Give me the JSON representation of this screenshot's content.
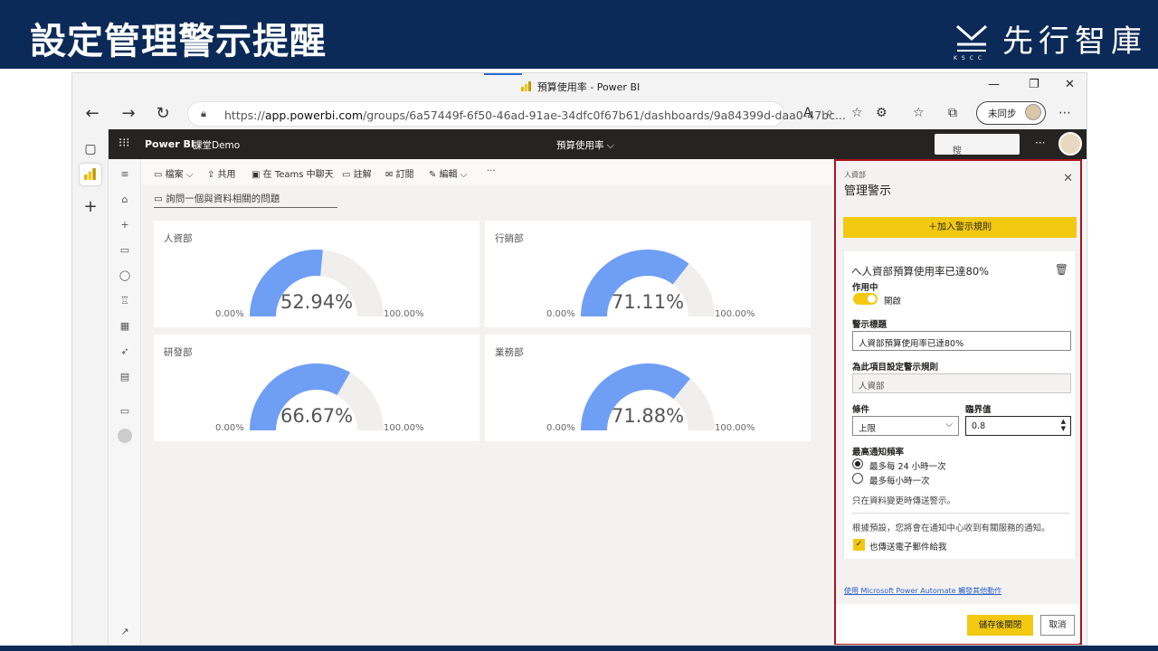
{
  "slide": {
    "title": "設定管理警示提醒",
    "logo_text": "先行智庫",
    "logo_sub": "KSCC"
  },
  "browser": {
    "tab_title": "預算使用率 - Power BI",
    "url_prefix": "https://",
    "url_host": "app.powerbi.com",
    "url_path": "/groups/6a57449f-6f50-46ad-91ae-34dfc0f67b61/dashboards/9a84399d-daa0-47bc...",
    "sync_label": "未同步",
    "window_controls": [
      "—",
      "❐",
      "✕"
    ]
  },
  "pbi": {
    "brand": "Power BI",
    "workspace": "課堂Demo",
    "center_title": "預算使用率 ⌵",
    "search_placeholder": "搜尋",
    "more": "···"
  },
  "commands": {
    "file": "檔案 ⌵",
    "share": "共用",
    "teams": "在 Teams 中聊天",
    "comment": "註解",
    "subscribe": "訂閱",
    "edit": "編輯 ⌵",
    "more": "···"
  },
  "qna_placeholder": "詢問一個與資料相關的問題",
  "tiles": [
    {
      "label": "人資部",
      "value": "52.94%",
      "fraction": 0.5294,
      "min": "0.00%",
      "max": "100.00%"
    },
    {
      "label": "行銷部",
      "value": "71.11%",
      "fraction": 0.7111,
      "min": "0.00%",
      "max": "100.00%"
    },
    {
      "label": "研發部",
      "value": "66.67%",
      "fraction": 0.6667,
      "min": "0.00%",
      "max": "100.00%"
    },
    {
      "label": "業務部",
      "value": "71.88%",
      "fraction": 0.7188,
      "min": "0.00%",
      "max": "100.00%"
    }
  ],
  "colors": {
    "gauge_fill": "#6f9ef5",
    "gauge_track": "#f0efee",
    "accent": "#f2c811",
    "highlight_border": "#b0131d"
  },
  "panel": {
    "crumb": "人資部",
    "title": "管理警示",
    "add_rule": "＋加入警示規則",
    "rule_header": "へ人資部預算使用率已達80%",
    "active_label": "作用中",
    "toggle_text": "開啟",
    "alert_title_label": "警示標題",
    "alert_title_value": "人資部預算使用率已達80%",
    "item_label": "為此項目設定警示規則",
    "item_value": "人資部",
    "condition_label": "條件",
    "condition_value": "上限",
    "threshold_label": "臨界值",
    "threshold_value": "0.8",
    "freq_label": "最高通知頻率",
    "freq_options": [
      "最多每 24 小時一次",
      "最多每小時一次"
    ],
    "freq_note": "只在資料變更時傳送警示。",
    "default_note": "根據預設，您將會在通知中心收到有關服務的通知。",
    "email_label": "也傳送電子郵件給我",
    "automate_link": "使用 Microsoft Power Automate 觸發其他動作",
    "save_button": "儲存後關閉",
    "cancel_button": "取消"
  }
}
